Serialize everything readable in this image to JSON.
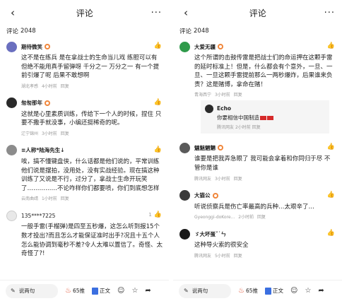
{
  "left": {
    "header": {
      "title": "评论",
      "back": "‹",
      "more": "···"
    },
    "count": {
      "label": "评论",
      "value": "2048"
    },
    "comments": [
      {
        "user": "期待微笑",
        "avatar_color": "#6a6fbf",
        "text": "这不是在练兵 是在拿战士的生命当儿戏 练胆可以有 但绝不能用真手留弹呀 千分之一 万分之一 有一个提前引爆了呢 后果不敢想啊",
        "location": "湖北孝感",
        "time": "4小时前",
        "reply": "回复",
        "likes": ""
      },
      {
        "user": "匆匆那年",
        "avatar_color": "#2a2a2a",
        "text": "这就是心里素质训练，传给下一个人的时候，捏住 只要不撒手就没事，小编还挺稀奇的呢。",
        "location": "辽宁锦州",
        "time": "3小时前",
        "reply": "回复",
        "likes": ""
      },
      {
        "user": "≡人称*陆海先生↓",
        "avatar_color": "#8c8c8c",
        "text": "唉，搞不懂键盘侠，什么话都是他们说的，平常训练他们说是摆拍，没用处，没有实战经验。现在搞这种训练了又说是不行，过分了，拿战士生命开玩笑了……………不论咋样你们都要喷，你们到底想怎样",
        "location": "云南曲靖",
        "time": "1小时前",
        "reply": "回复",
        "likes": ""
      },
      {
        "user": "135****7225",
        "avatar_color": "#e8e8e8",
        "text": "一般手雷(手榴弹)是四至五秒爆，这怎么听到报15个数才投出?而且怎么才能保证准时出手?况且十五个人怎么能协调到毫秒不差?令人太难以置信了。奇怪、太奇怪了?!",
        "location": "",
        "time": "",
        "reply": "",
        "likes": "1"
      }
    ],
    "bottom": {
      "say": "说两句",
      "hot": "65推",
      "body": "正文"
    }
  },
  "right": {
    "header": {
      "title": "评论",
      "back": "‹",
      "more": "···"
    },
    "count": {
      "label": "评论",
      "value": "2048"
    },
    "comments": [
      {
        "user": "大爱无疆",
        "avatar_color": "#2f9a4a",
        "text": "这个所谓的击鼓传雷是把战士们的命运押在这颗手雷的延时标准上！但是，什么都会有个意外，一旦、一旦、一旦这颗手雷提前那么一两秒爆炸，后果谁来负责？这是赌博，拿命在赌！",
        "location": "青海西宁",
        "time": "3小时前",
        "reply": "回复",
        "likes": ""
      },
      {
        "user": "魑魅魍魉",
        "avatar_color": "#5a5a5a",
        "text": "谁要是把我弄急眼了 我可能会拿着和你同归于尽 不管你是谁",
        "location": "腾讯网友",
        "time": "3小时前",
        "reply": "回复",
        "likes": ""
      },
      {
        "user": "大猫公",
        "avatar_color": "#3a3a3a",
        "text": "听说侦察兵是伤亡率最高的兵种…太艰辛了…",
        "location": "Gyeonggi-doKore...",
        "time": "2小时前",
        "reply": "回复",
        "likes": ""
      },
      {
        "user": "ゞ大坏蛋ˇ˙ㄣ",
        "avatar_color": "#1a1a1a",
        "text": "这种导火索的很安全",
        "location": "腾讯网友",
        "time": "5小时前",
        "reply": "回复",
        "likes": ""
      }
    ],
    "reply": {
      "user": "Echo",
      "avatar_color": "#2a2a2a",
      "text": "你要相信中国制造",
      "location": "腾讯网友",
      "time": "2小时前",
      "reply": "回复"
    },
    "bottom": {
      "say": "说两句",
      "hot": "65推",
      "body": "正文"
    }
  }
}
